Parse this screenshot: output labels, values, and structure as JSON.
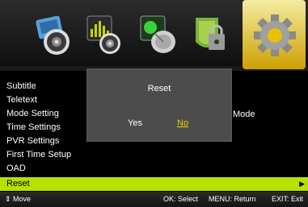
{
  "tabs": [
    {
      "name": "picture-tab",
      "icon": "picture-speaker-icon"
    },
    {
      "name": "sound-tab",
      "icon": "sound-equalizer-icon"
    },
    {
      "name": "channel-tab",
      "icon": "satellite-dish-icon"
    },
    {
      "name": "lock-tab",
      "icon": "lock-icon"
    },
    {
      "name": "setup-tab",
      "icon": "gear-icon",
      "active": true
    }
  ],
  "menu": {
    "items": [
      {
        "label": "Subtitle"
      },
      {
        "label": "Teletext"
      },
      {
        "label": "Mode Setting"
      },
      {
        "label": "Time Settings"
      },
      {
        "label": "PVR Settings"
      },
      {
        "label": "First Time Setup"
      },
      {
        "label": "OAD"
      },
      {
        "label": "Reset",
        "selected": true
      }
    ],
    "selected_arrow": "▶",
    "right_label": "Mode"
  },
  "dialog": {
    "title": "Reset",
    "yes_label": "Yes",
    "no_label": "No",
    "focused": "No"
  },
  "footer": {
    "move_icon": "updown-arrows-icon",
    "move_label": "⇕ Move",
    "ok_label": "OK: Select",
    "menu_label": "MENU: Return",
    "exit_label": "EXIT: Exit"
  },
  "colors": {
    "highlight": "#b8e000",
    "dialog_bg": "#4c4c4c",
    "focus_text": "#e8d800"
  }
}
